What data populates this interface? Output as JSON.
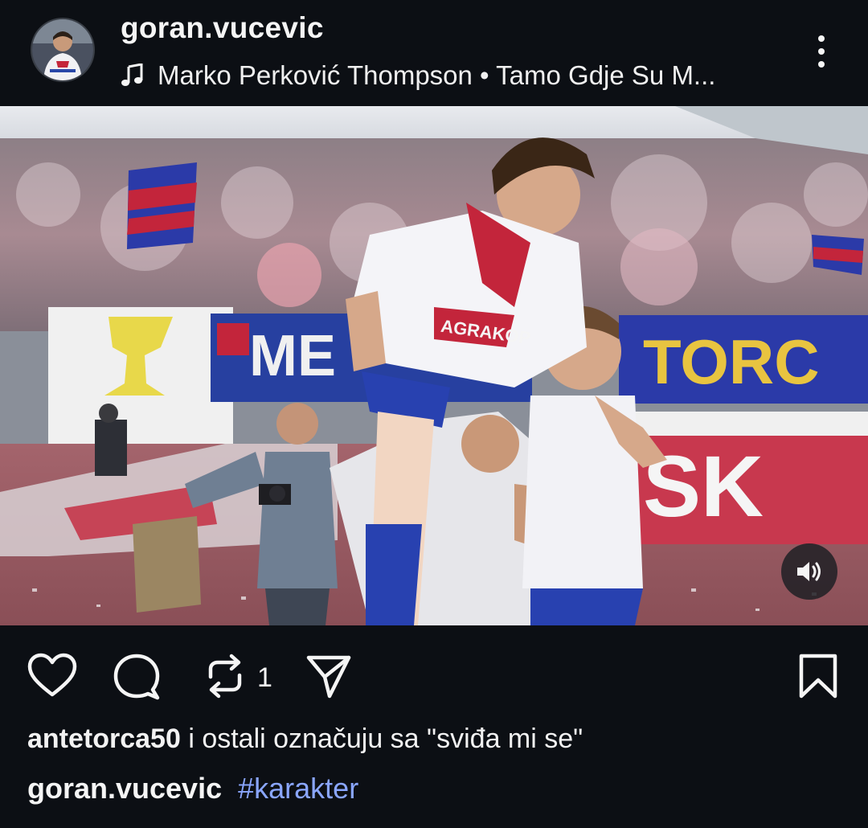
{
  "header": {
    "username": "goran.vucevic",
    "audio": "Marko Perković Thompson • Tamo Gdje Su M...",
    "avatar_icon": "profile-photo",
    "more_icon": "more-vertical-icon"
  },
  "media": {
    "sound_icon": "volume-icon",
    "jersey_sponsor": "AGRAKOP",
    "banner_text": "TORC",
    "banner_text_2": "SK"
  },
  "actions": {
    "like_icon": "heart-icon",
    "comment_icon": "comment-icon",
    "repost_icon": "repost-icon",
    "repost_count": "1",
    "share_icon": "send-icon",
    "save_icon": "bookmark-icon"
  },
  "likes": {
    "user": "antetorca50",
    "text": " i ostali označuju sa \"sviđa mi se\""
  },
  "caption": {
    "author": "goran.vucevic",
    "hashtag": "#karakter"
  },
  "colors": {
    "background": "#0c0f14",
    "hashtag": "#8aa6ff",
    "text": "#f5f5f5"
  }
}
